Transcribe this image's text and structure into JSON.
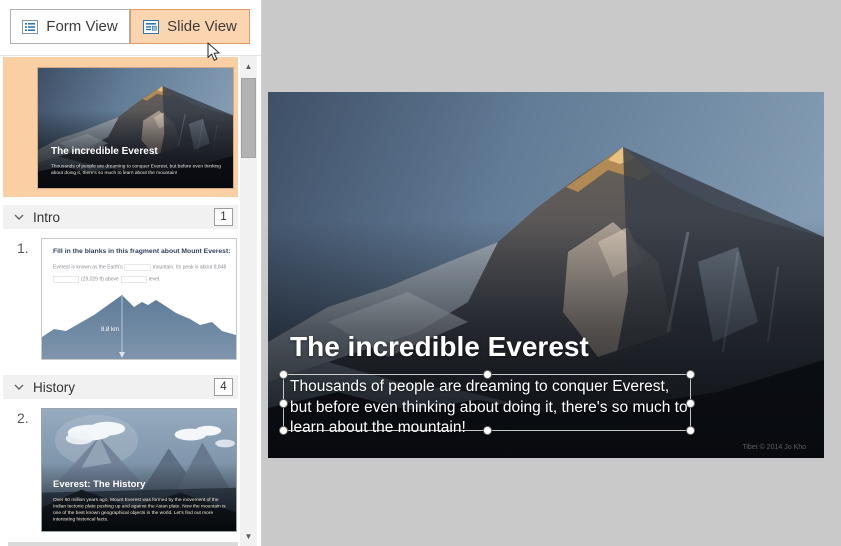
{
  "view_toggle": {
    "form_view_label": "Form View",
    "slide_view_label": "Slide View",
    "active": "Slide View"
  },
  "sidebar": {
    "sections": [
      {
        "label": "Intro",
        "count": "1"
      },
      {
        "label": "History",
        "count": "4"
      }
    ],
    "items": [
      {
        "number": "1.",
        "question_title": "Fill in the blanks in this fragment about Mount Everest:",
        "line1a": "Everest is known as the Earth's",
        "line1b": "mountain. Its peak is about 8,848",
        "line2a": "(29,029 ft) above",
        "line2b": "level.",
        "chart_label": "8.8 km"
      },
      {
        "number": "2.",
        "title": "Everest: The History",
        "body": "Over 60 million years ago, Mount Everest was formed by the movement of the Indian tectonic plate pushing up and against the Asian plate. Now the mountain is one of the best known geographical objects in the world. Let's find out more interesting historical facts."
      }
    ]
  },
  "slide": {
    "title": "The incredible Everest",
    "body": "Thousands of people are dreaming to conquer Everest, but before even thinking about doing it, there's so much to learn about the mountain!",
    "watermark": "Tibet © 2014  Jo Kho"
  },
  "colors": {
    "accent_orange_border": "#e49a64",
    "accent_orange_fill": "#fbd5af",
    "selected_thumb_bg": "#fbcfa4",
    "icon_blue": "#2e75b6",
    "app_background": "#c9c9c9",
    "chart_mountain_blue": "#5e7b99"
  }
}
